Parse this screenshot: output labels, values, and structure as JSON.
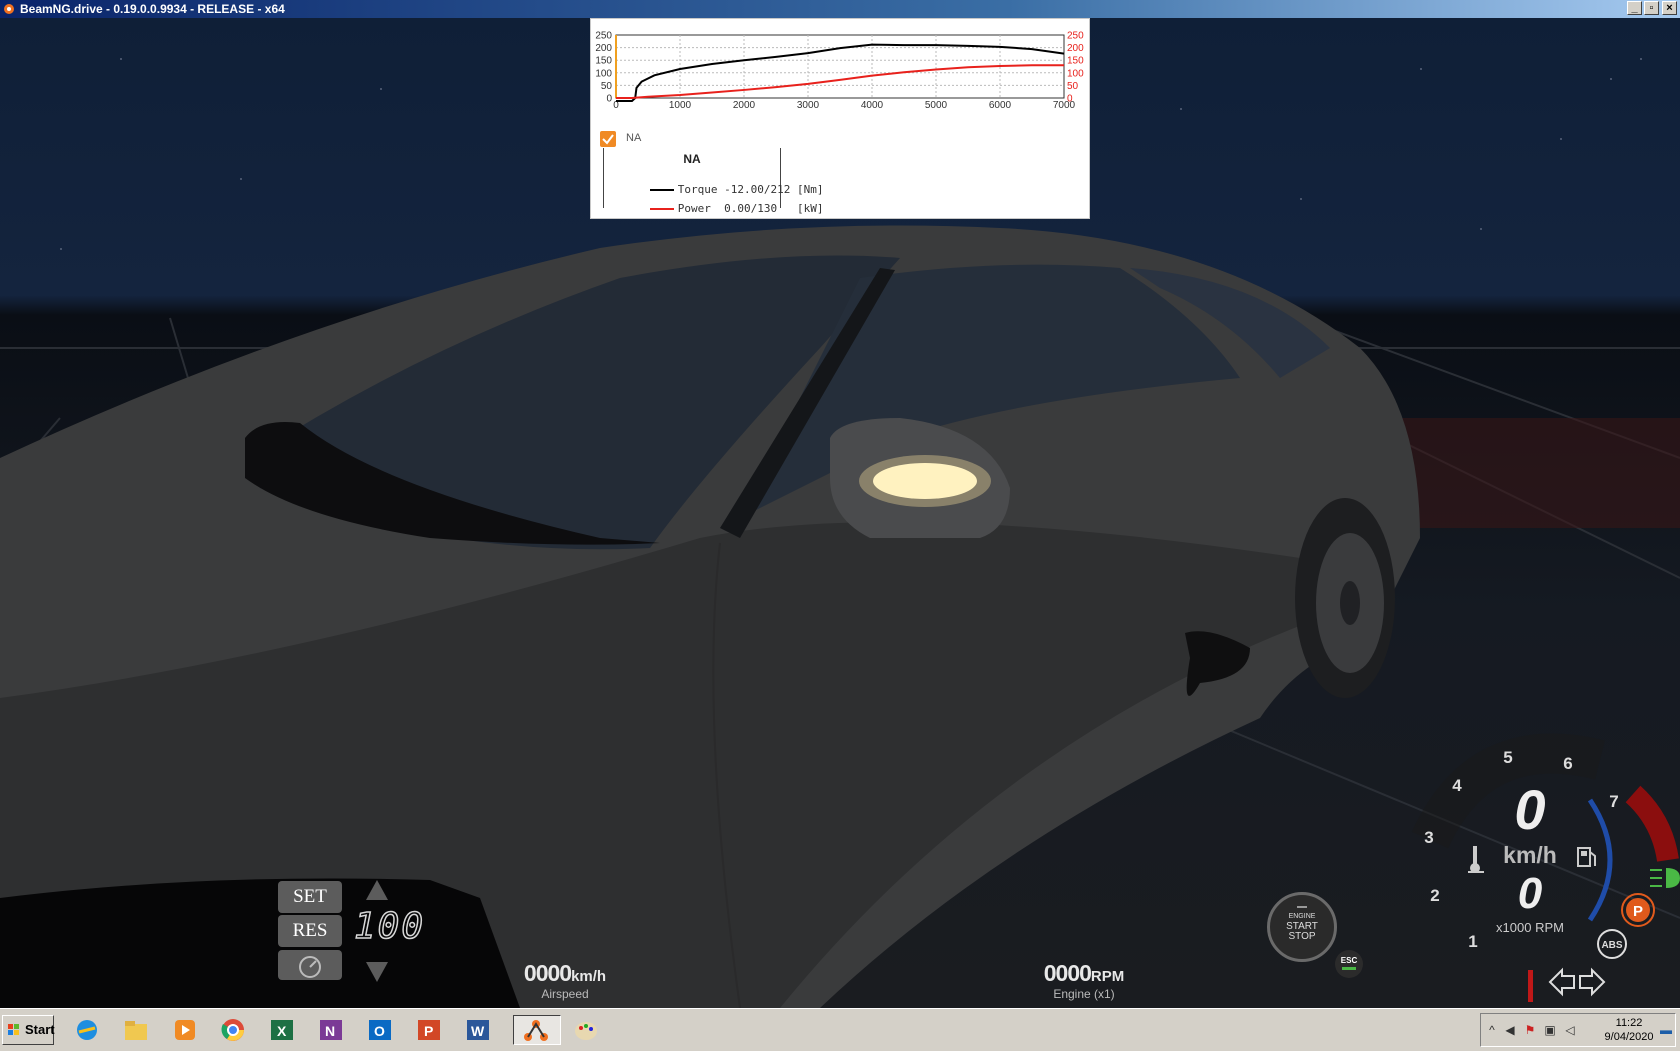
{
  "window": {
    "title": "BeamNG.drive - 0.19.0.0.9934 - RELEASE - x64",
    "controls": [
      "_",
      "▫",
      "×"
    ]
  },
  "chart_data": {
    "type": "line",
    "x_ticks": [
      "0",
      "1000",
      "2000",
      "3000",
      "4000",
      "5000",
      "6000",
      "7000"
    ],
    "y_ticks_left": [
      "250",
      "200",
      "150",
      "100",
      "50",
      "0"
    ],
    "y_ticks_right": [
      "250",
      "200",
      "150",
      "100",
      "50",
      "0"
    ],
    "xlim": [
      0,
      7000
    ],
    "ylim": [
      0,
      250
    ],
    "grid": true,
    "series": [
      {
        "name": "Torque",
        "color": "#000000",
        "x": [
          0,
          250,
          300,
          320,
          400,
          600,
          1000,
          1500,
          2000,
          2500,
          3000,
          3500,
          4000,
          4500,
          5000,
          5500,
          6000,
          6500,
          7000
        ],
        "y": [
          -12,
          -12,
          0,
          40,
          65,
          90,
          115,
          135,
          150,
          163,
          178,
          198,
          212,
          210,
          210,
          207,
          203,
          194,
          176
        ]
      },
      {
        "name": "Power",
        "color": "#e8211c",
        "x": [
          0,
          250,
          500,
          1000,
          1500,
          2000,
          2500,
          3000,
          3500,
          4000,
          4500,
          5000,
          5500,
          6000,
          6500,
          7000
        ],
        "y": [
          0,
          0,
          5,
          12,
          22,
          32,
          43,
          56,
          72,
          89,
          102,
          113,
          122,
          127,
          130,
          130
        ]
      }
    ],
    "legend": {
      "checkbox_label": "NA",
      "table_title": "NA",
      "rows": [
        {
          "label": "Torque -12.00/212 [Nm]",
          "color": "#000000"
        },
        {
          "label": "Power  0.00/130   [kW]",
          "color": "#e8211c"
        }
      ]
    }
  },
  "hud": {
    "cruise": {
      "set_label": "SET",
      "res_label": "RES",
      "speed": "100"
    },
    "airspeed": {
      "value": "0000",
      "unit": "km/h",
      "label": "Airspeed"
    },
    "engine": {
      "value": "0000",
      "unit": "RPM",
      "label": "Engine (x1)"
    },
    "startstop": {
      "line1": "ENGINE",
      "line2": "START",
      "line3": "STOP"
    },
    "esc_label": "ESC",
    "gauge": {
      "speed": "0",
      "speed_unit": "km/h",
      "rpm": "0",
      "rpm_unit": "x1000 RPM",
      "rpm_numbers": [
        "1",
        "2",
        "3",
        "4",
        "5",
        "6",
        "7"
      ],
      "parking_label": "P",
      "abs_label": "ABS"
    }
  },
  "taskbar": {
    "start_label": "Start",
    "apps": [
      "internet-explorer",
      "file-explorer",
      "media-player",
      "chrome",
      "excel",
      "onenote",
      "outlook",
      "powerpoint",
      "word",
      "beamng",
      "paint"
    ],
    "clock_time": "11:22",
    "clock_date": "9/04/2020"
  },
  "colors": {
    "accent_orange": "#f08a24",
    "redline": "#8b0e0e",
    "gauge_blue": "#1f4ca8",
    "taskbar": "#d4d0c8"
  }
}
